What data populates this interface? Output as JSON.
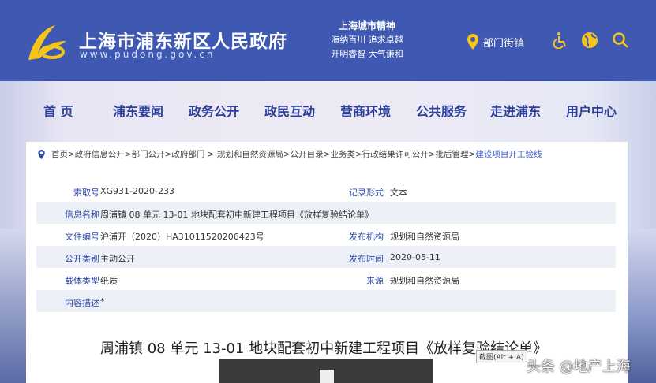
{
  "header": {
    "title": "上海市浦东新区人民政府",
    "url": "www.pudong.gov.cn",
    "motto_title": "上海城市精神",
    "motto_line1": "海纳百川  追求卓越",
    "motto_line2": "开明睿智  大气谦和",
    "dept_label": "部门街镇"
  },
  "nav": [
    "首  页",
    "浦东要闻",
    "政务公开",
    "政民互动",
    "营商环境",
    "公共服务",
    "走进浦东",
    "用户中心"
  ],
  "breadcrumb": {
    "path": "首页>政府信息公开>部门公开>政府部门 > 规划和自然资源局>公开目录>业务类>行政结果许可公开>批后管理>",
    "current": "建设项目开工验线"
  },
  "info": [
    {
      "label": "索取号",
      "value": "XG931-2020-233",
      "label2": "记录形式",
      "value2": "文本"
    },
    {
      "label": "信息名称",
      "value": "周浦镇 08 单元 13-01 地块配套初中新建工程项目《放样复验结论单》",
      "label2": "",
      "value2": ""
    },
    {
      "label": "文件编号",
      "value": "沪浦开（2020）HA31011520206423号",
      "label2": "发布机构",
      "value2": "规划和自然资源局"
    },
    {
      "label": "公开类别",
      "value": "主动公开",
      "label2": "发布时间",
      "value2": "2020-05-11"
    },
    {
      "label": "载体类型",
      "value": "纸质",
      "label2": "来源",
      "value2": "规划和自然资源局"
    },
    {
      "label": "内容描述",
      "value": "*",
      "label2": "",
      "value2": ""
    }
  ],
  "doc_title": "周浦镇 08 单元 13-01 地块配套初中新建工程项目《放样复验结论单》",
  "tooltip": "截图(Alt + A)",
  "watermark": "头条 @地产上海",
  "colors": {
    "header": "#3f58b1",
    "nav_text": "#2c3f97",
    "accent": "#f5c518"
  }
}
